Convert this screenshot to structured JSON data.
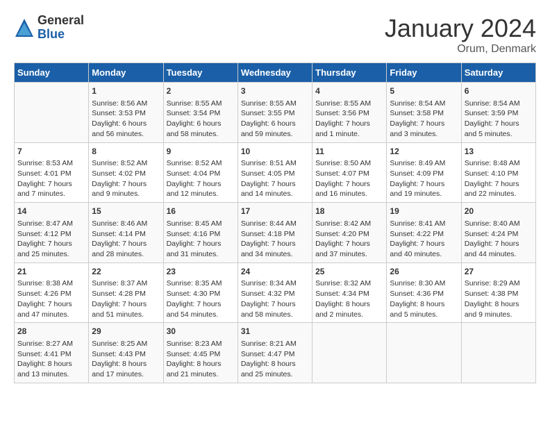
{
  "logo": {
    "general": "General",
    "blue": "Blue"
  },
  "title": "January 2024",
  "subtitle": "Orum, Denmark",
  "headers": [
    "Sunday",
    "Monday",
    "Tuesday",
    "Wednesday",
    "Thursday",
    "Friday",
    "Saturday"
  ],
  "weeks": [
    [
      {
        "day": "",
        "lines": []
      },
      {
        "day": "1",
        "lines": [
          "Sunrise: 8:56 AM",
          "Sunset: 3:53 PM",
          "Daylight: 6 hours",
          "and 56 minutes."
        ]
      },
      {
        "day": "2",
        "lines": [
          "Sunrise: 8:55 AM",
          "Sunset: 3:54 PM",
          "Daylight: 6 hours",
          "and 58 minutes."
        ]
      },
      {
        "day": "3",
        "lines": [
          "Sunrise: 8:55 AM",
          "Sunset: 3:55 PM",
          "Daylight: 6 hours",
          "and 59 minutes."
        ]
      },
      {
        "day": "4",
        "lines": [
          "Sunrise: 8:55 AM",
          "Sunset: 3:56 PM",
          "Daylight: 7 hours",
          "and 1 minute."
        ]
      },
      {
        "day": "5",
        "lines": [
          "Sunrise: 8:54 AM",
          "Sunset: 3:58 PM",
          "Daylight: 7 hours",
          "and 3 minutes."
        ]
      },
      {
        "day": "6",
        "lines": [
          "Sunrise: 8:54 AM",
          "Sunset: 3:59 PM",
          "Daylight: 7 hours",
          "and 5 minutes."
        ]
      }
    ],
    [
      {
        "day": "7",
        "lines": [
          "Sunrise: 8:53 AM",
          "Sunset: 4:01 PM",
          "Daylight: 7 hours",
          "and 7 minutes."
        ]
      },
      {
        "day": "8",
        "lines": [
          "Sunrise: 8:52 AM",
          "Sunset: 4:02 PM",
          "Daylight: 7 hours",
          "and 9 minutes."
        ]
      },
      {
        "day": "9",
        "lines": [
          "Sunrise: 8:52 AM",
          "Sunset: 4:04 PM",
          "Daylight: 7 hours",
          "and 12 minutes."
        ]
      },
      {
        "day": "10",
        "lines": [
          "Sunrise: 8:51 AM",
          "Sunset: 4:05 PM",
          "Daylight: 7 hours",
          "and 14 minutes."
        ]
      },
      {
        "day": "11",
        "lines": [
          "Sunrise: 8:50 AM",
          "Sunset: 4:07 PM",
          "Daylight: 7 hours",
          "and 16 minutes."
        ]
      },
      {
        "day": "12",
        "lines": [
          "Sunrise: 8:49 AM",
          "Sunset: 4:09 PM",
          "Daylight: 7 hours",
          "and 19 minutes."
        ]
      },
      {
        "day": "13",
        "lines": [
          "Sunrise: 8:48 AM",
          "Sunset: 4:10 PM",
          "Daylight: 7 hours",
          "and 22 minutes."
        ]
      }
    ],
    [
      {
        "day": "14",
        "lines": [
          "Sunrise: 8:47 AM",
          "Sunset: 4:12 PM",
          "Daylight: 7 hours",
          "and 25 minutes."
        ]
      },
      {
        "day": "15",
        "lines": [
          "Sunrise: 8:46 AM",
          "Sunset: 4:14 PM",
          "Daylight: 7 hours",
          "and 28 minutes."
        ]
      },
      {
        "day": "16",
        "lines": [
          "Sunrise: 8:45 AM",
          "Sunset: 4:16 PM",
          "Daylight: 7 hours",
          "and 31 minutes."
        ]
      },
      {
        "day": "17",
        "lines": [
          "Sunrise: 8:44 AM",
          "Sunset: 4:18 PM",
          "Daylight: 7 hours",
          "and 34 minutes."
        ]
      },
      {
        "day": "18",
        "lines": [
          "Sunrise: 8:42 AM",
          "Sunset: 4:20 PM",
          "Daylight: 7 hours",
          "and 37 minutes."
        ]
      },
      {
        "day": "19",
        "lines": [
          "Sunrise: 8:41 AM",
          "Sunset: 4:22 PM",
          "Daylight: 7 hours",
          "and 40 minutes."
        ]
      },
      {
        "day": "20",
        "lines": [
          "Sunrise: 8:40 AM",
          "Sunset: 4:24 PM",
          "Daylight: 7 hours",
          "and 44 minutes."
        ]
      }
    ],
    [
      {
        "day": "21",
        "lines": [
          "Sunrise: 8:38 AM",
          "Sunset: 4:26 PM",
          "Daylight: 7 hours",
          "and 47 minutes."
        ]
      },
      {
        "day": "22",
        "lines": [
          "Sunrise: 8:37 AM",
          "Sunset: 4:28 PM",
          "Daylight: 7 hours",
          "and 51 minutes."
        ]
      },
      {
        "day": "23",
        "lines": [
          "Sunrise: 8:35 AM",
          "Sunset: 4:30 PM",
          "Daylight: 7 hours",
          "and 54 minutes."
        ]
      },
      {
        "day": "24",
        "lines": [
          "Sunrise: 8:34 AM",
          "Sunset: 4:32 PM",
          "Daylight: 7 hours",
          "and 58 minutes."
        ]
      },
      {
        "day": "25",
        "lines": [
          "Sunrise: 8:32 AM",
          "Sunset: 4:34 PM",
          "Daylight: 8 hours",
          "and 2 minutes."
        ]
      },
      {
        "day": "26",
        "lines": [
          "Sunrise: 8:30 AM",
          "Sunset: 4:36 PM",
          "Daylight: 8 hours",
          "and 5 minutes."
        ]
      },
      {
        "day": "27",
        "lines": [
          "Sunrise: 8:29 AM",
          "Sunset: 4:38 PM",
          "Daylight: 8 hours",
          "and 9 minutes."
        ]
      }
    ],
    [
      {
        "day": "28",
        "lines": [
          "Sunrise: 8:27 AM",
          "Sunset: 4:41 PM",
          "Daylight: 8 hours",
          "and 13 minutes."
        ]
      },
      {
        "day": "29",
        "lines": [
          "Sunrise: 8:25 AM",
          "Sunset: 4:43 PM",
          "Daylight: 8 hours",
          "and 17 minutes."
        ]
      },
      {
        "day": "30",
        "lines": [
          "Sunrise: 8:23 AM",
          "Sunset: 4:45 PM",
          "Daylight: 8 hours",
          "and 21 minutes."
        ]
      },
      {
        "day": "31",
        "lines": [
          "Sunrise: 8:21 AM",
          "Sunset: 4:47 PM",
          "Daylight: 8 hours",
          "and 25 minutes."
        ]
      },
      {
        "day": "",
        "lines": []
      },
      {
        "day": "",
        "lines": []
      },
      {
        "day": "",
        "lines": []
      }
    ]
  ]
}
